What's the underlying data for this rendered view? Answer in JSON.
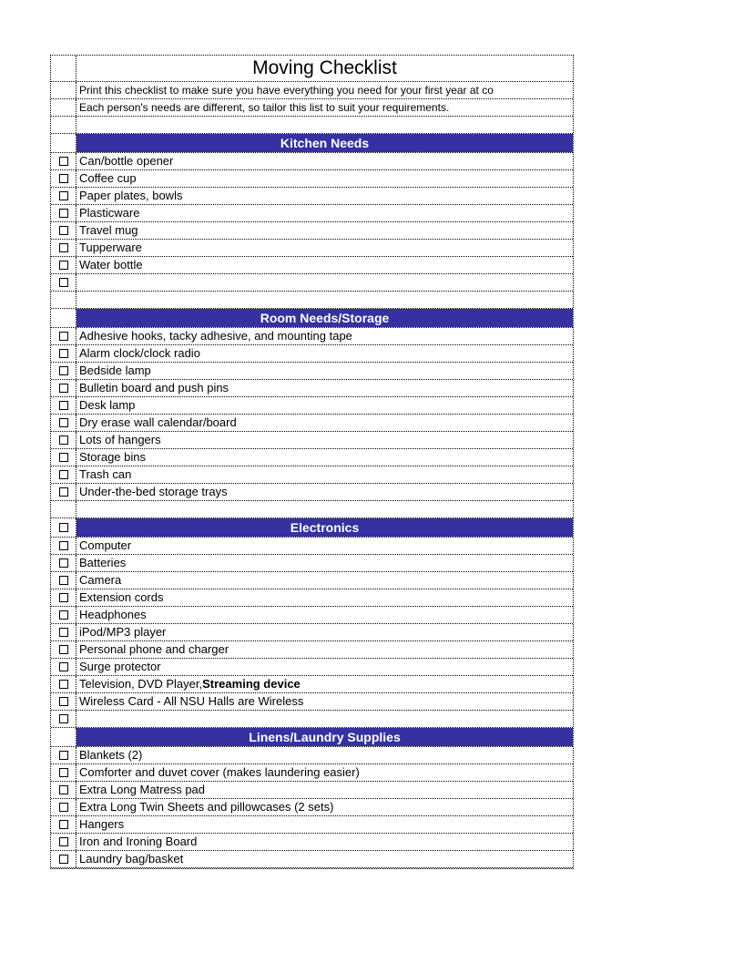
{
  "title": "Moving Checklist",
  "subtitle_lines": [
    "Print this checklist to make sure you have everything you need for your first year at co",
    "Each person's needs are different, so tailor this list to suit your requirements."
  ],
  "sections": [
    {
      "header": "Kitchen Needs",
      "header_has_checkbox": false,
      "items": [
        "Can/bottle opener",
        "Coffee cup",
        "Paper plates, bowls",
        "Plasticware",
        "Travel mug",
        "Tupperware",
        "Water bottle"
      ],
      "trailing_empty_checkbox": true
    },
    {
      "header": "Room Needs/Storage",
      "header_has_checkbox": false,
      "items": [
        "Adhesive hooks, tacky adhesive, and mounting tape",
        "Alarm clock/clock radio",
        "Bedside lamp",
        "Bulletin board and push pins",
        "Desk lamp",
        "Dry erase wall calendar/board",
        "Lots of hangers",
        "Storage bins",
        "Trash can",
        "Under-the-bed storage trays"
      ],
      "trailing_empty_checkbox": false
    },
    {
      "header": "Electronics",
      "header_has_checkbox": true,
      "items": [
        "Computer",
        "Batteries",
        "Camera",
        "Extension cords",
        "Headphones",
        "iPod/MP3 player",
        "Personal phone and charger",
        "Surge protector",
        {
          "prefix": "Television, DVD Player, ",
          "bold": "Streaming device"
        },
        "Wireless Card - All NSU Halls are Wireless"
      ],
      "trailing_empty_checkbox": true
    },
    {
      "header": "Linens/Laundry Supplies",
      "header_has_checkbox": false,
      "items": [
        "Blankets (2)",
        "Comforter and duvet cover (makes laundering easier)",
        "Extra Long Matress pad",
        "Extra Long Twin Sheets and pillowcases (2 sets)",
        "Hangers",
        "Iron and Ironing Board",
        "Laundry bag/basket"
      ],
      "trailing_empty_checkbox": false,
      "no_spacer_before": true
    }
  ]
}
